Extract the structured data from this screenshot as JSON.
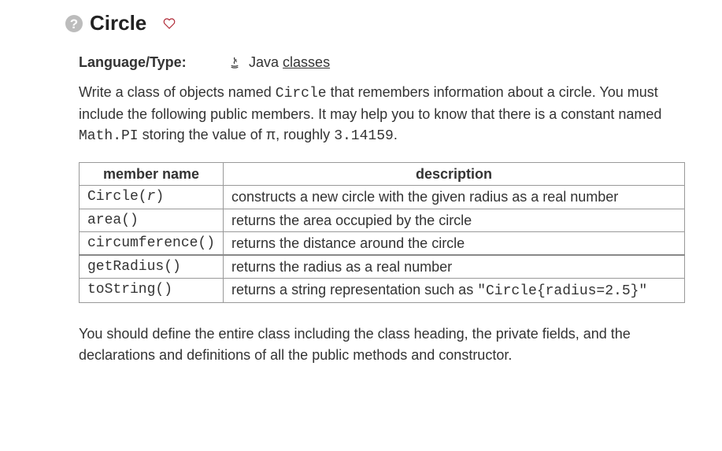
{
  "title": "Circle",
  "meta": {
    "label": "Language/Type:",
    "language": "Java",
    "link": "classes"
  },
  "intro": {
    "t1": "Write a class of objects named ",
    "c1": "Circle",
    "t2": " that remembers information about a circle. You must include the following public members. It may help you to know that there is a constant named ",
    "c2": "Math.PI",
    "t3": " storing the value of π, roughly ",
    "c3": "3.14159",
    "t4": "."
  },
  "table": {
    "headers": {
      "name": "member name",
      "desc": "description"
    },
    "rows": [
      {
        "name_pre": "Circle(",
        "name_arg": "r",
        "name_post": ")",
        "desc": "constructs a new circle with the given radius as a real number",
        "thickAfter": false
      },
      {
        "name": "area()",
        "desc": "returns the area occupied by the circle",
        "thickAfter": false
      },
      {
        "name": "circumference()",
        "desc": "returns the distance around the circle",
        "thickAfter": true
      },
      {
        "name": "getRadius()",
        "desc": "returns the radius as a real number",
        "thickAfter": false
      },
      {
        "name": "toString()",
        "desc_pre": "returns a string representation such as ",
        "desc_code": "\"Circle{radius=2.5}\"",
        "thickAfter": false
      }
    ]
  },
  "outro": "You should define the entire class including the class heading, the private fields, and the declarations and definitions of all the public methods and constructor."
}
